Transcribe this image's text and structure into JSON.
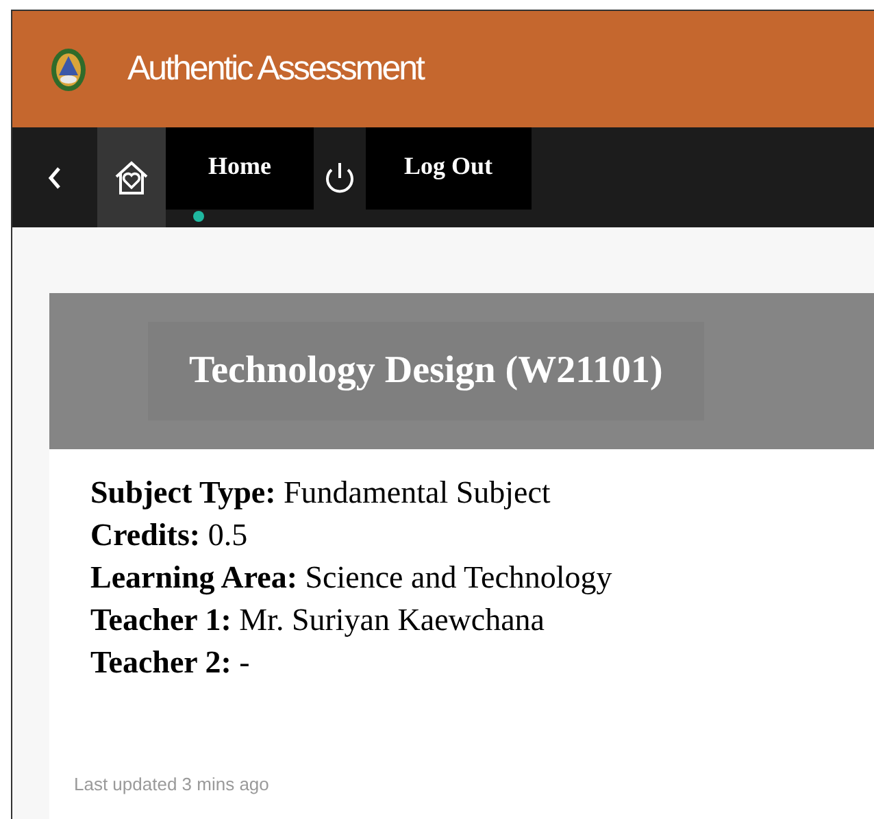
{
  "header": {
    "title": "Authentic Assessment"
  },
  "nav": [
    {
      "kind": "back"
    },
    {
      "kind": "home",
      "selected": true
    },
    {
      "kind": "label",
      "label": "Home"
    },
    {
      "kind": "power",
      "selected": false
    },
    {
      "kind": "label",
      "label": "Log Out"
    }
  ],
  "card": {
    "title": "Technology Design (W21101)",
    "fields": [
      "**Subject Type:** Fundamental Subject",
      "**Credits:** 0.5",
      "**Learning Area:** Science and Technology",
      "**Teacher 1:** Mr. Suriyan Kaewchana",
      "**Teacher 2:** -"
    ],
    "footer": "Last updated 3 mins ago"
  }
}
